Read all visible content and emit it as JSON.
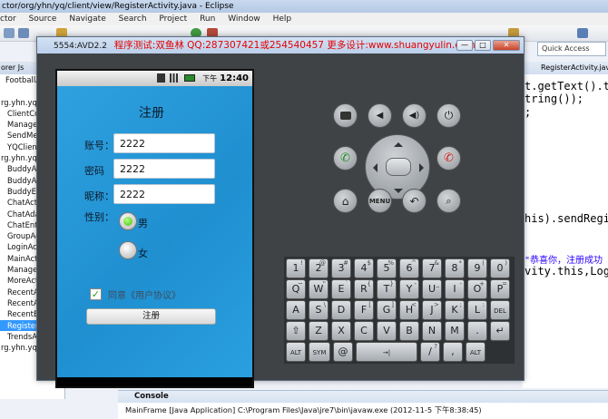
{
  "eclipse": {
    "title": "ctor/org/yhn/yq/client/view/RegisterActivity.java - Eclipse",
    "menu": [
      "ctor",
      "Source",
      "Navigate",
      "Search",
      "Project",
      "Run",
      "Window",
      "Help"
    ],
    "quick_access": "Quick Access",
    "left_tabs": "orer  Js",
    "project_items": [
      "FootballAct",
      "",
      "rg.yhn.yq.c",
      "ClientCon",
      "ManageC",
      "SendMes",
      "YQClient",
      "rg.yhn.yq.c",
      "BuddyAct",
      "BuddyAd",
      "BuddyEn",
      "ChatActiv",
      "ChatAdap",
      "ChatEntit",
      "GroupAct",
      "LoginActi",
      "MainActiv",
      "ManageA",
      "MoreActi",
      "RecentAc",
      "RecentAc",
      "RecentEn",
      "RegisterActivity.java",
      "TrendsActivty.java",
      "rg.yhn.yq.common"
    ],
    "editor_tab": "RegisterActivity.java",
    "code_lines": [
      "t.getText().to",
      "tring());",
      ";",
      "his).sendRegis",
      "\"恭喜你，注册成功",
      "vity.this,Logi"
    ],
    "console_tab": "Console",
    "console_line": "MainFrame [Java Application] C:\\Program Files\\Java\\jre7\\bin\\javaw.exe (2012-11-5 下午8:38:45)"
  },
  "emulator": {
    "avd": "5554:AVD2.2",
    "ad_text": "程序测试:双鱼林 QQ:287307421或254540457 更多设计:www.shuangyulin.com",
    "window_buttons": [
      "—",
      "□",
      "✕"
    ],
    "status_ampm": "下午",
    "status_time": "12:40",
    "app": {
      "title": "注册",
      "account_label": "账号：",
      "account_value": "2222",
      "password_label": "密码",
      "password_value": "2222",
      "nickname_label": "昵称：",
      "nickname_value": "2222",
      "gender_label": "性别：",
      "male": "男",
      "female": "女",
      "agree": "同意《用户协议》",
      "register_button": "注册"
    },
    "hardware": {
      "menu": "MENU"
    },
    "keyboard": {
      "row1": [
        [
          "1",
          "!"
        ],
        [
          "2",
          "@"
        ],
        [
          "3",
          "#"
        ],
        [
          "4",
          "$"
        ],
        [
          "5",
          "%"
        ],
        [
          "6",
          "^"
        ],
        [
          "7",
          "&"
        ],
        [
          "8",
          "*"
        ],
        [
          "9",
          "("
        ],
        [
          "0",
          ")"
        ]
      ],
      "row2": [
        [
          "Q",
          "~"
        ],
        [
          "W",
          "\""
        ],
        [
          "E",
          "`"
        ],
        [
          "R",
          "{"
        ],
        [
          "T",
          "}"
        ],
        [
          "Y",
          "-"
        ],
        [
          "U",
          "_"
        ],
        [
          "I",
          "-"
        ],
        [
          "O",
          "+"
        ],
        [
          "P",
          "="
        ]
      ],
      "row3": [
        [
          "A",
          ""
        ],
        [
          "S",
          "\\"
        ],
        [
          "D",
          ""
        ],
        [
          "F",
          "["
        ],
        [
          "G",
          "]"
        ],
        [
          "H",
          "<"
        ],
        [
          "J",
          ">"
        ],
        [
          "K",
          ";"
        ],
        [
          "L",
          ":"
        ],
        [
          "DEL",
          ""
        ]
      ],
      "row4": [
        [
          "⇧",
          ""
        ],
        [
          "Z",
          ""
        ],
        [
          "X",
          ""
        ],
        [
          "C",
          ""
        ],
        [
          "V",
          ""
        ],
        [
          "B",
          ""
        ],
        [
          "N",
          ""
        ],
        [
          "M",
          ""
        ],
        [
          ".",
          ""
        ],
        [
          "↵",
          ""
        ]
      ],
      "row5": [
        [
          "ALT",
          ""
        ],
        [
          "SYM",
          ""
        ],
        [
          "@",
          ""
        ],
        [
          "→|",
          ""
        ],
        [
          "/",
          "?"
        ],
        [
          ",",
          ""
        ],
        [
          "ALT",
          ""
        ]
      ]
    }
  }
}
